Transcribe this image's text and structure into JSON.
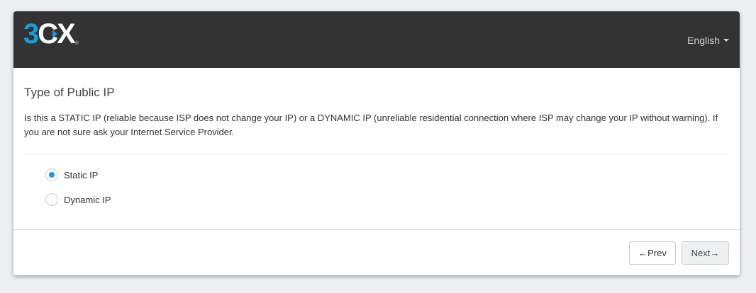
{
  "header": {
    "logo": {
      "three": "3",
      "cx": "CX",
      "tm": "®"
    },
    "language": "English"
  },
  "main": {
    "title": "Type of Public IP",
    "description": "Is this a STATIC IP (reliable because ISP does not change your IP) or a DYNAMIC IP (unreliable residential connection where ISP may change your IP without warning). If you are not sure ask your Internet Service Provider.",
    "options": [
      {
        "label": "Static IP",
        "selected": true
      },
      {
        "label": "Dynamic IP",
        "selected": false
      }
    ]
  },
  "footer": {
    "prev_label": "←Prev",
    "next_label": "Next→"
  },
  "colors": {
    "header_bg": "#333333",
    "accent": "#1a9ad6",
    "page_bg": "#ecf0f1"
  }
}
